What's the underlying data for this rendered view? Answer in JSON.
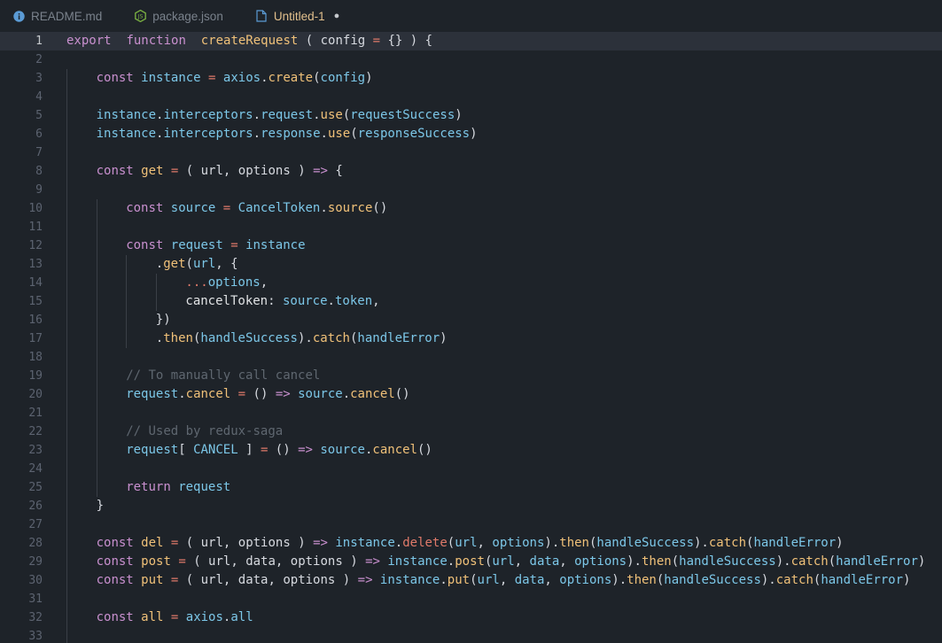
{
  "tabs": [
    {
      "label": "README.md",
      "icon": "info-icon",
      "active": false,
      "dirty": false
    },
    {
      "label": "package.json",
      "icon": "nodejs-icon",
      "active": false,
      "dirty": false
    },
    {
      "label": "Untitled-1",
      "icon": "file-icon",
      "active": true,
      "dirty": true
    }
  ],
  "dirty_marker": "●",
  "current_line": 1,
  "lines": [
    {
      "n": "1",
      "indent": 0,
      "tokens": [
        [
          "c-export",
          "export"
        ],
        [
          "",
          "  "
        ],
        [
          "c-export",
          "function"
        ],
        [
          "",
          "  "
        ],
        [
          "c-func",
          "createRequest"
        ],
        [
          "c-plain",
          " ( config "
        ],
        [
          "c-op",
          "="
        ],
        [
          "c-plain",
          " {} ) {"
        ]
      ]
    },
    {
      "n": "2",
      "indent": 0,
      "tokens": []
    },
    {
      "n": "3",
      "indent": 1,
      "tokens": [
        [
          "c-const",
          "const"
        ],
        [
          "c-name",
          " instance "
        ],
        [
          "c-op",
          "="
        ],
        [
          "c-name",
          " axios"
        ],
        [
          "c-plain",
          "."
        ],
        [
          "c-method",
          "create"
        ],
        [
          "c-plain",
          "("
        ],
        [
          "c-name",
          "config"
        ],
        [
          "c-plain",
          ")"
        ]
      ]
    },
    {
      "n": "4",
      "indent": 1,
      "tokens": []
    },
    {
      "n": "5",
      "indent": 1,
      "tokens": [
        [
          "c-name",
          "instance"
        ],
        [
          "c-plain",
          "."
        ],
        [
          "c-name",
          "interceptors"
        ],
        [
          "c-plain",
          "."
        ],
        [
          "c-name",
          "request"
        ],
        [
          "c-plain",
          "."
        ],
        [
          "c-method",
          "use"
        ],
        [
          "c-plain",
          "("
        ],
        [
          "c-name",
          "requestSuccess"
        ],
        [
          "c-plain",
          ")"
        ]
      ]
    },
    {
      "n": "6",
      "indent": 1,
      "tokens": [
        [
          "c-name",
          "instance"
        ],
        [
          "c-plain",
          "."
        ],
        [
          "c-name",
          "interceptors"
        ],
        [
          "c-plain",
          "."
        ],
        [
          "c-name",
          "response"
        ],
        [
          "c-plain",
          "."
        ],
        [
          "c-method",
          "use"
        ],
        [
          "c-plain",
          "("
        ],
        [
          "c-name",
          "responseSuccess"
        ],
        [
          "c-plain",
          ")"
        ]
      ]
    },
    {
      "n": "7",
      "indent": 1,
      "tokens": []
    },
    {
      "n": "8",
      "indent": 1,
      "tokens": [
        [
          "c-const",
          "const"
        ],
        [
          "c-func",
          " get "
        ],
        [
          "c-op",
          "="
        ],
        [
          "c-plain",
          " ( url, options ) "
        ],
        [
          "c-arrow",
          "=>"
        ],
        [
          "c-plain",
          " {"
        ]
      ]
    },
    {
      "n": "9",
      "indent": 1,
      "tokens": []
    },
    {
      "n": "10",
      "indent": 2,
      "tokens": [
        [
          "c-const",
          "const"
        ],
        [
          "c-name",
          " source "
        ],
        [
          "c-op",
          "="
        ],
        [
          "c-name",
          " CancelToken"
        ],
        [
          "c-plain",
          "."
        ],
        [
          "c-method",
          "source"
        ],
        [
          "c-plain",
          "()"
        ]
      ]
    },
    {
      "n": "11",
      "indent": 2,
      "tokens": []
    },
    {
      "n": "12",
      "indent": 2,
      "tokens": [
        [
          "c-const",
          "const"
        ],
        [
          "c-name",
          " request "
        ],
        [
          "c-op",
          "="
        ],
        [
          "c-name",
          " instance"
        ]
      ]
    },
    {
      "n": "13",
      "indent": 3,
      "tokens": [
        [
          "c-plain",
          "."
        ],
        [
          "c-method",
          "get"
        ],
        [
          "c-plain",
          "("
        ],
        [
          "c-name",
          "url"
        ],
        [
          "c-plain",
          ", {"
        ]
      ]
    },
    {
      "n": "14",
      "indent": 4,
      "tokens": [
        [
          "c-op",
          "..."
        ],
        [
          "c-name",
          "options"
        ],
        [
          "c-plain",
          ","
        ]
      ]
    },
    {
      "n": "15",
      "indent": 4,
      "tokens": [
        [
          "c-param",
          "cancelToken"
        ],
        [
          "c-plain",
          ": "
        ],
        [
          "c-name",
          "source"
        ],
        [
          "c-plain",
          "."
        ],
        [
          "c-name",
          "token"
        ],
        [
          "c-plain",
          ","
        ]
      ]
    },
    {
      "n": "16",
      "indent": 3,
      "tokens": [
        [
          "c-plain",
          "})"
        ]
      ]
    },
    {
      "n": "17",
      "indent": 3,
      "tokens": [
        [
          "c-plain",
          "."
        ],
        [
          "c-method",
          "then"
        ],
        [
          "c-plain",
          "("
        ],
        [
          "c-name",
          "handleSuccess"
        ],
        [
          "c-plain",
          ")."
        ],
        [
          "c-method",
          "catch"
        ],
        [
          "c-plain",
          "("
        ],
        [
          "c-name",
          "handleError"
        ],
        [
          "c-plain",
          ")"
        ]
      ]
    },
    {
      "n": "18",
      "indent": 2,
      "tokens": []
    },
    {
      "n": "19",
      "indent": 2,
      "tokens": [
        [
          "c-comment",
          "// To manually call cancel"
        ]
      ]
    },
    {
      "n": "20",
      "indent": 2,
      "tokens": [
        [
          "c-name",
          "request"
        ],
        [
          "c-plain",
          "."
        ],
        [
          "c-method",
          "cancel"
        ],
        [
          "c-op",
          " = "
        ],
        [
          "c-plain",
          "() "
        ],
        [
          "c-arrow",
          "=>"
        ],
        [
          "c-name",
          " source"
        ],
        [
          "c-plain",
          "."
        ],
        [
          "c-method",
          "cancel"
        ],
        [
          "c-plain",
          "()"
        ]
      ]
    },
    {
      "n": "21",
      "indent": 2,
      "tokens": []
    },
    {
      "n": "22",
      "indent": 2,
      "tokens": [
        [
          "c-comment",
          "// Used by redux-saga"
        ]
      ]
    },
    {
      "n": "23",
      "indent": 2,
      "tokens": [
        [
          "c-name",
          "request"
        ],
        [
          "c-plain",
          "[ "
        ],
        [
          "c-name",
          "CANCEL"
        ],
        [
          "c-plain",
          " ] "
        ],
        [
          "c-op",
          "="
        ],
        [
          "c-plain",
          " () "
        ],
        [
          "c-arrow",
          "=>"
        ],
        [
          "c-name",
          " source"
        ],
        [
          "c-plain",
          "."
        ],
        [
          "c-method",
          "cancel"
        ],
        [
          "c-plain",
          "()"
        ]
      ]
    },
    {
      "n": "24",
      "indent": 2,
      "tokens": []
    },
    {
      "n": "25",
      "indent": 2,
      "tokens": [
        [
          "c-return",
          "return"
        ],
        [
          "c-name",
          " request"
        ]
      ]
    },
    {
      "n": "26",
      "indent": 1,
      "tokens": [
        [
          "c-plain",
          "}"
        ]
      ]
    },
    {
      "n": "27",
      "indent": 1,
      "tokens": []
    },
    {
      "n": "28",
      "indent": 1,
      "tokens": [
        [
          "c-const",
          "const"
        ],
        [
          "c-func",
          " del "
        ],
        [
          "c-op",
          "="
        ],
        [
          "c-plain",
          " ( url, options ) "
        ],
        [
          "c-arrow",
          "=>"
        ],
        [
          "c-name",
          " instance"
        ],
        [
          "c-plain",
          "."
        ],
        [
          "c-del",
          "delete"
        ],
        [
          "c-plain",
          "("
        ],
        [
          "c-name",
          "url"
        ],
        [
          "c-plain",
          ", "
        ],
        [
          "c-name",
          "options"
        ],
        [
          "c-plain",
          ")."
        ],
        [
          "c-method",
          "then"
        ],
        [
          "c-plain",
          "("
        ],
        [
          "c-name",
          "handleSuccess"
        ],
        [
          "c-plain",
          ")."
        ],
        [
          "c-method",
          "catch"
        ],
        [
          "c-plain",
          "("
        ],
        [
          "c-name",
          "handleError"
        ],
        [
          "c-plain",
          ")"
        ]
      ]
    },
    {
      "n": "29",
      "indent": 1,
      "tokens": [
        [
          "c-const",
          "const"
        ],
        [
          "c-func",
          " post "
        ],
        [
          "c-op",
          "="
        ],
        [
          "c-plain",
          " ( url, data, options ) "
        ],
        [
          "c-arrow",
          "=>"
        ],
        [
          "c-name",
          " instance"
        ],
        [
          "c-plain",
          "."
        ],
        [
          "c-method",
          "post"
        ],
        [
          "c-plain",
          "("
        ],
        [
          "c-name",
          "url"
        ],
        [
          "c-plain",
          ", "
        ],
        [
          "c-name",
          "data"
        ],
        [
          "c-plain",
          ", "
        ],
        [
          "c-name",
          "options"
        ],
        [
          "c-plain",
          ")."
        ],
        [
          "c-method",
          "then"
        ],
        [
          "c-plain",
          "("
        ],
        [
          "c-name",
          "handleSuccess"
        ],
        [
          "c-plain",
          ")."
        ],
        [
          "c-method",
          "catch"
        ],
        [
          "c-plain",
          "("
        ],
        [
          "c-name",
          "handleError"
        ],
        [
          "c-plain",
          ")"
        ]
      ]
    },
    {
      "n": "30",
      "indent": 1,
      "tokens": [
        [
          "c-const",
          "const"
        ],
        [
          "c-func",
          " put "
        ],
        [
          "c-op",
          "="
        ],
        [
          "c-plain",
          " ( url, data, options ) "
        ],
        [
          "c-arrow",
          "=>"
        ],
        [
          "c-name",
          " instance"
        ],
        [
          "c-plain",
          "."
        ],
        [
          "c-method",
          "put"
        ],
        [
          "c-plain",
          "("
        ],
        [
          "c-name",
          "url"
        ],
        [
          "c-plain",
          ", "
        ],
        [
          "c-name",
          "data"
        ],
        [
          "c-plain",
          ", "
        ],
        [
          "c-name",
          "options"
        ],
        [
          "c-plain",
          ")."
        ],
        [
          "c-method",
          "then"
        ],
        [
          "c-plain",
          "("
        ],
        [
          "c-name",
          "handleSuccess"
        ],
        [
          "c-plain",
          ")."
        ],
        [
          "c-method",
          "catch"
        ],
        [
          "c-plain",
          "("
        ],
        [
          "c-name",
          "handleError"
        ],
        [
          "c-plain",
          ")"
        ]
      ]
    },
    {
      "n": "31",
      "indent": 1,
      "tokens": []
    },
    {
      "n": "32",
      "indent": 1,
      "tokens": [
        [
          "c-const",
          "const"
        ],
        [
          "c-func",
          " all "
        ],
        [
          "c-op",
          "="
        ],
        [
          "c-name",
          " axios"
        ],
        [
          "c-plain",
          "."
        ],
        [
          "c-name",
          "all"
        ]
      ]
    },
    {
      "n": "33",
      "indent": 1,
      "tokens": []
    }
  ],
  "colors": {
    "background": "#1e2329",
    "current_line": "#2c313a",
    "active_tab_text": "#e2c08d",
    "line_number": "#5c6370"
  }
}
